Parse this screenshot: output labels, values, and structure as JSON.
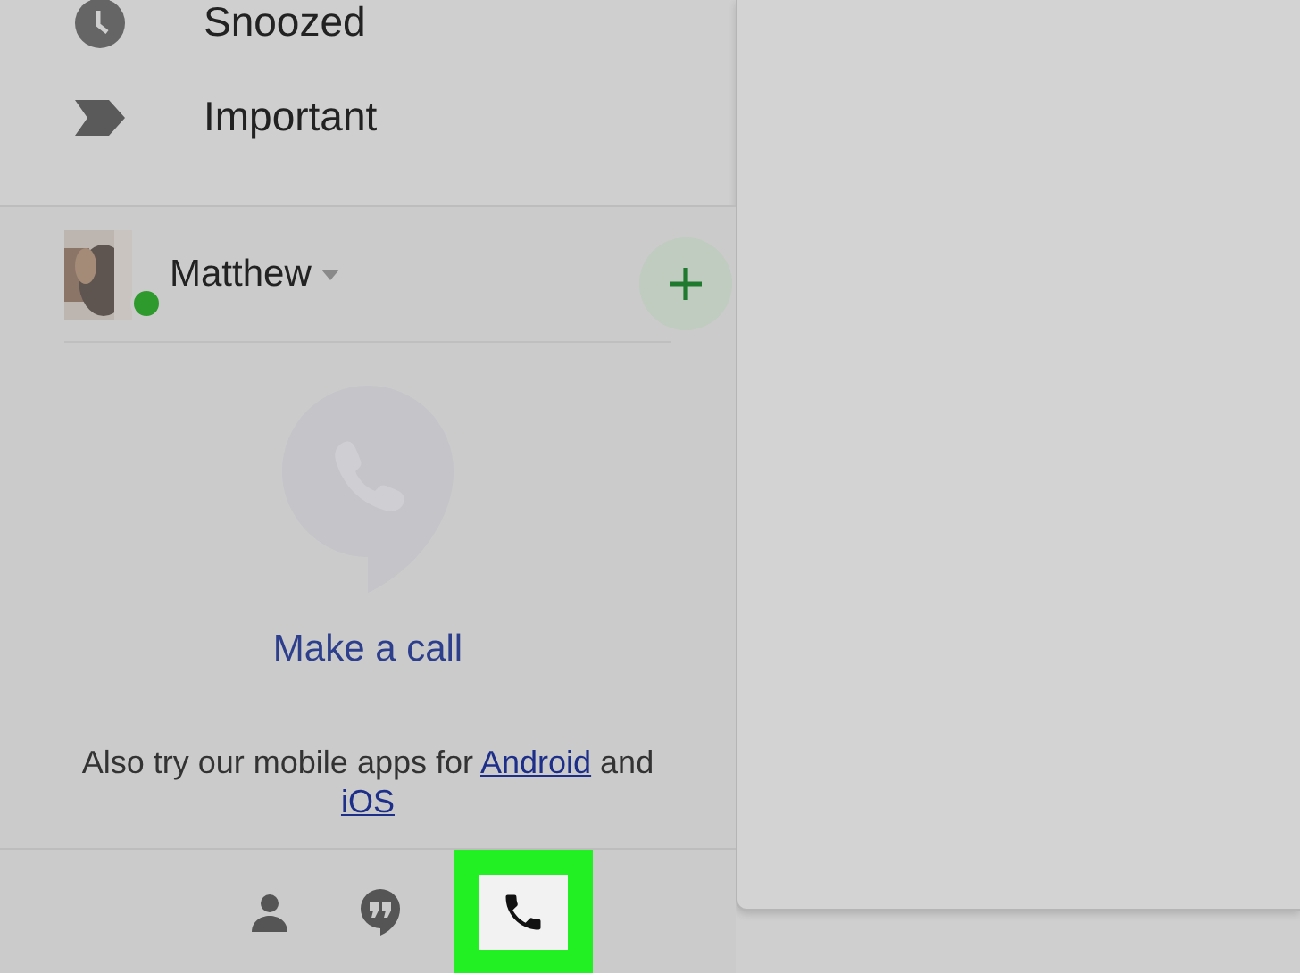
{
  "nav_items": [
    {
      "label": "Snoozed",
      "kind": "clock"
    },
    {
      "label": "Important",
      "kind": "important"
    }
  ],
  "hangouts": {
    "user": {
      "name": "Matthew",
      "online": true
    },
    "empty_state": {
      "action": "Make a call",
      "note_before": "Also try our mobile apps for",
      "link_1": "Android",
      "note_middle": "and",
      "link_2": "iOS"
    },
    "tabs": [
      {
        "kind": "contacts",
        "selected": false
      },
      {
        "kind": "chats",
        "selected": false
      },
      {
        "kind": "phone",
        "selected": true
      }
    ]
  }
}
